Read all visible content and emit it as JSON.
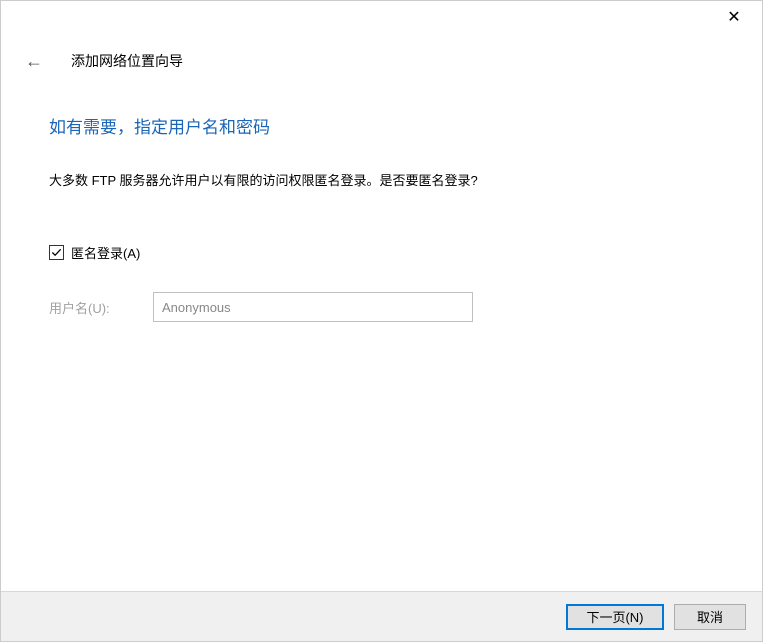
{
  "titlebar": {
    "close_glyph": "✕"
  },
  "wizard": {
    "back_glyph": "←",
    "title": "添加网络位置向导"
  },
  "content": {
    "heading": "如有需要，指定用户名和密码",
    "description": "大多数 FTP 服务器允许用户以有限的访问权限匿名登录。是否要匿名登录?",
    "anonymous_checkbox_label": "匿名登录(A)",
    "username_label": "用户名(U):",
    "username_value": "Anonymous"
  },
  "footer": {
    "next_label": "下一页(N)",
    "cancel_label": "取消"
  }
}
